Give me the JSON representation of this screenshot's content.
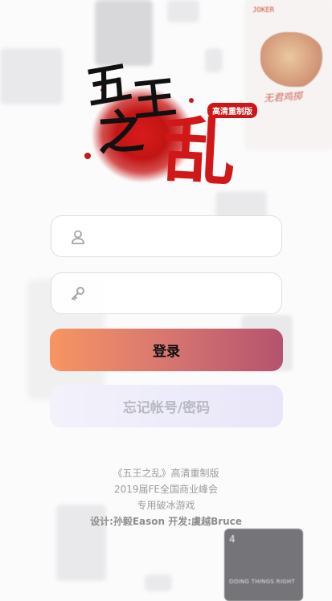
{
  "logo": {
    "chars": [
      "五",
      "王",
      "之",
      "乱"
    ],
    "badge": "高清重制版"
  },
  "background": {
    "joker_letters": "JOKER",
    "joker_signature": "无君鸡掷",
    "card_number": "4",
    "card_caption": "DOING THINGS RIGHT"
  },
  "login": {
    "username": {
      "icon": "user-icon",
      "value": "",
      "placeholder": ""
    },
    "password": {
      "icon": "key-icon",
      "value": "",
      "placeholder": ""
    },
    "login_label": "登录",
    "forgot_label": "忘记帐号/密码"
  },
  "footer": {
    "line1": "《五王之乱》高清重制版",
    "line2": "2019届FE全国商业峰会",
    "line3": "专用破冰游戏",
    "line4": "设计:孙毅Eason 开发:虞越Bruce"
  },
  "colors": {
    "accent_start": "#f79563",
    "accent_end": "#b4536e",
    "logo_red": "#d11818"
  }
}
